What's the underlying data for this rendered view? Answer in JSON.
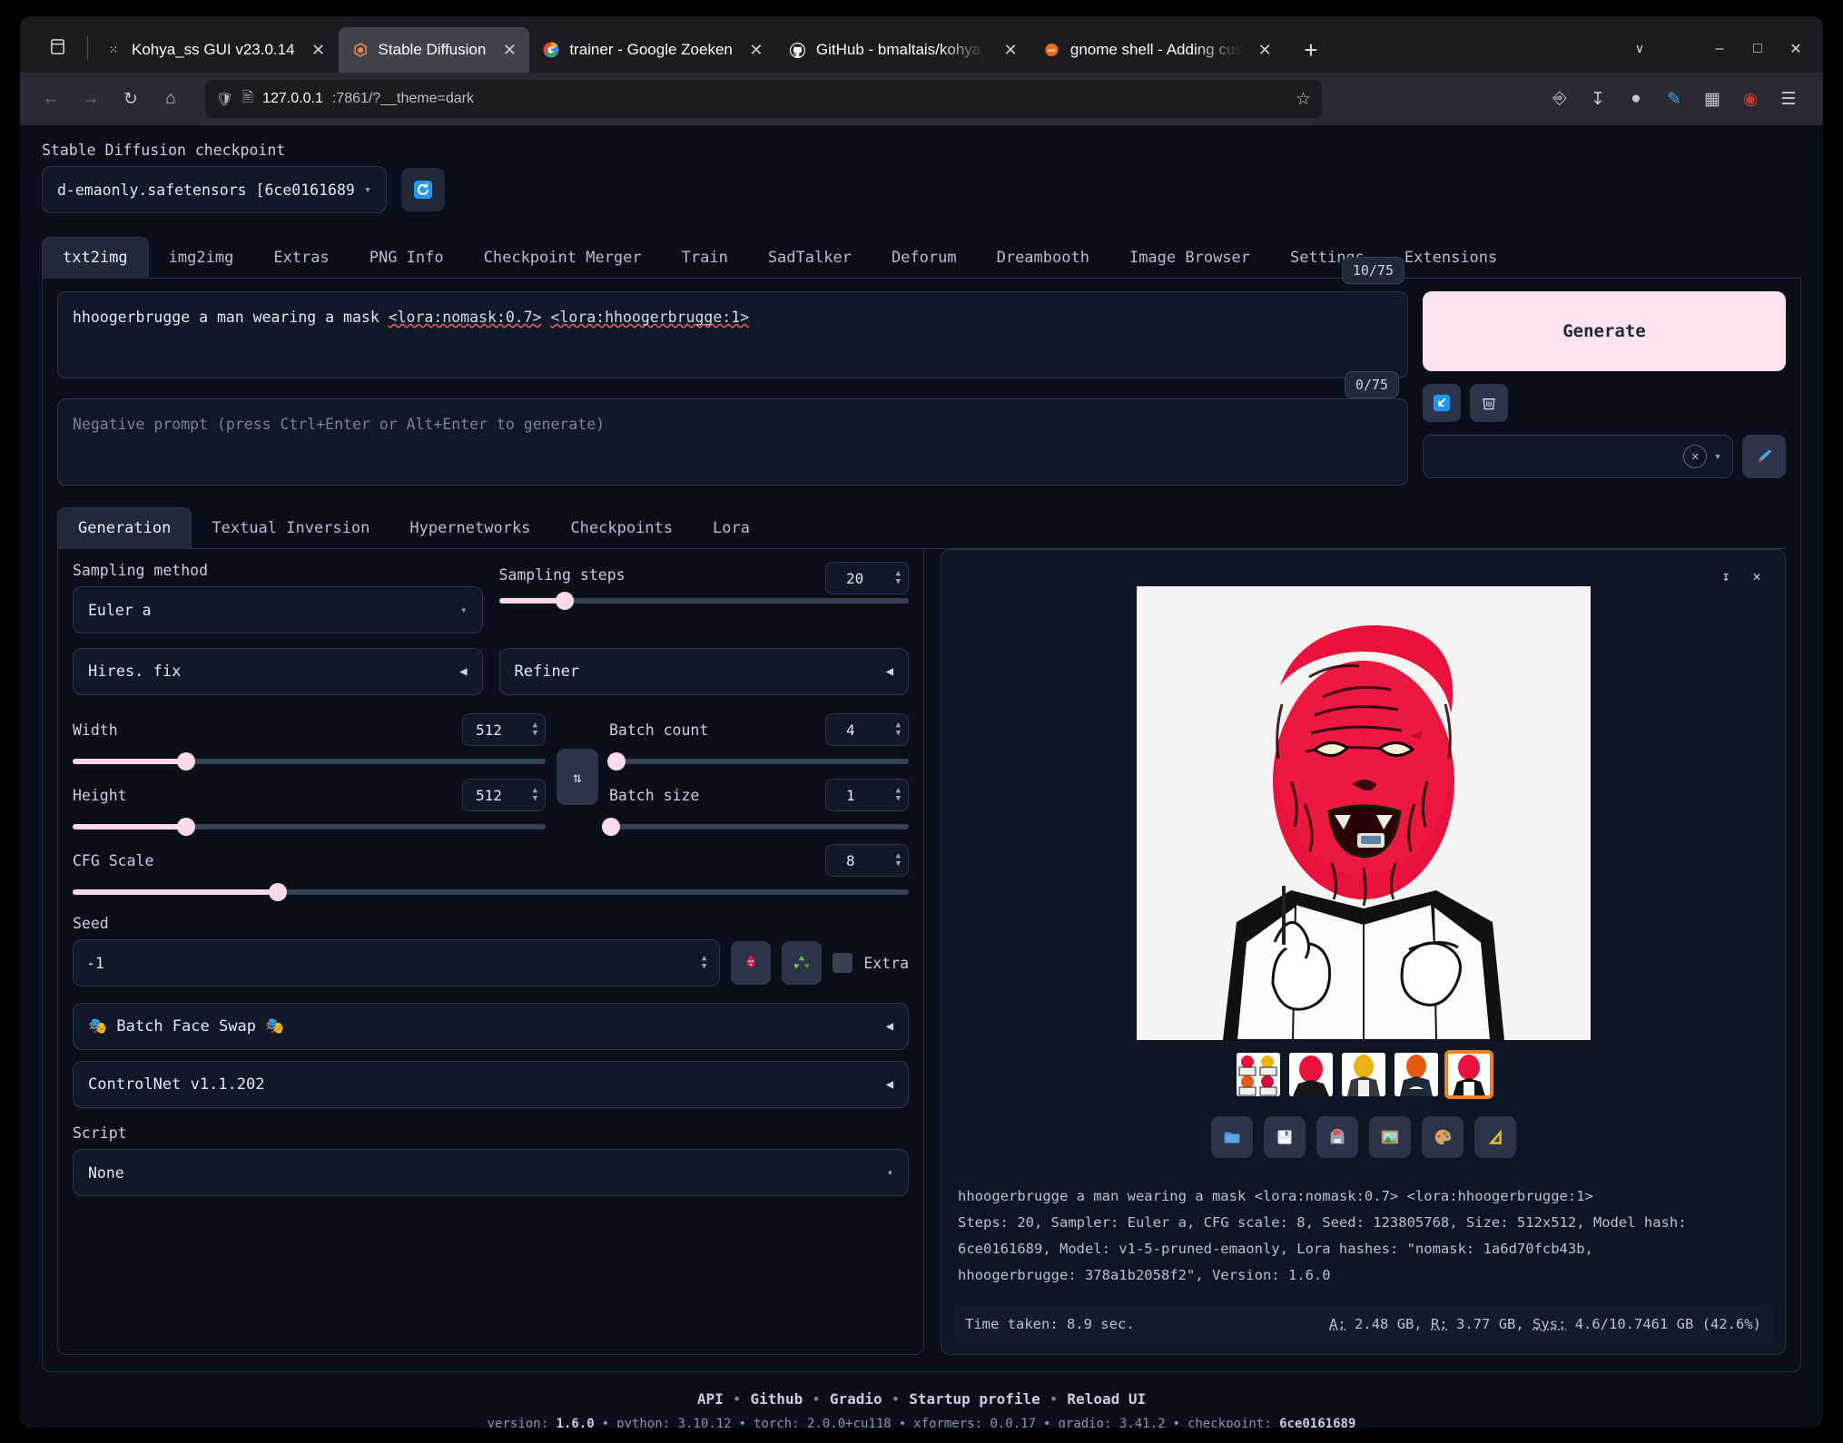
{
  "browser": {
    "tabs": [
      {
        "label": "Kohya_ss GUI v23.0.14",
        "icon": "dots-icon",
        "active": false
      },
      {
        "label": "Stable Diffusion",
        "icon": "gradio-icon",
        "active": true
      },
      {
        "label": "trainer - Google Zoeken",
        "icon": "google-icon",
        "active": false
      },
      {
        "label": "GitHub - bmaltais/kohya_",
        "icon": "github-icon",
        "active": false
      },
      {
        "label": "gnome shell - Adding cust",
        "icon": "askubuntu-icon",
        "active": false
      }
    ],
    "close_label": "✕",
    "newtab_label": "+",
    "list_all_tabs_label": "∨",
    "window_minimize": "–",
    "window_maximize": "□",
    "window_close": "✕",
    "nav": {
      "back": "←",
      "forward": "→",
      "reload": "↻",
      "home": "⌂",
      "bookmark": "☆"
    },
    "url": {
      "host": "127.0.0.1",
      "path": ":7861/?__theme=dark"
    },
    "toolbar_icons": [
      "pocket-icon",
      "downloads-icon",
      "account-icon",
      "color-picker-icon",
      "extensions-icon",
      "ublock-icon",
      "menu-icon"
    ]
  },
  "checkpoint": {
    "label": "Stable Diffusion checkpoint",
    "value": "d-emaonly.safetensors [6ce0161689",
    "caret": "▾",
    "refresh_icon": "refresh-icon"
  },
  "main_tabs": [
    {
      "label": "txt2img",
      "active": true
    },
    {
      "label": "img2img",
      "active": false
    },
    {
      "label": "Extras",
      "active": false
    },
    {
      "label": "PNG Info",
      "active": false
    },
    {
      "label": "Checkpoint Merger",
      "active": false
    },
    {
      "label": "Train",
      "active": false
    },
    {
      "label": "SadTalker",
      "active": false
    },
    {
      "label": "Deforum",
      "active": false
    },
    {
      "label": "Dreambooth",
      "active": false
    },
    {
      "label": "Image Browser",
      "active": false
    },
    {
      "label": "Settings",
      "active": false
    },
    {
      "label": "Extensions",
      "active": false
    }
  ],
  "prompt": {
    "text_plain": "hhoogerbrugge a man wearing a mask ",
    "lora1": "<lora:nomask:0.7>",
    "lora2": "<lora:hhoogerbrugge:1>",
    "counter": "10/75",
    "negative_placeholder": "Negative prompt (press Ctrl+Enter or Alt+Enter to generate)",
    "negative_counter": "0/75"
  },
  "generate": {
    "label": "Generate",
    "paste_icon": "paste-arrow-icon",
    "clear_icon": "trash-icon",
    "styles_clear": "✕",
    "styles_caret": "▾",
    "brush_icon": "paintbrush-icon"
  },
  "sub_tabs": [
    {
      "label": "Generation",
      "active": true
    },
    {
      "label": "Textual Inversion",
      "active": false
    },
    {
      "label": "Hypernetworks",
      "active": false
    },
    {
      "label": "Checkpoints",
      "active": false
    },
    {
      "label": "Lora",
      "active": false
    }
  ],
  "params": {
    "sampling_method_label": "Sampling method",
    "sampling_method_value": "Euler a",
    "sampling_steps_label": "Sampling steps",
    "sampling_steps_value": "20",
    "hires_fix_label": "Hires. fix",
    "refiner_label": "Refiner",
    "width_label": "Width",
    "width_value": "512",
    "height_label": "Height",
    "height_value": "512",
    "cfg_label": "CFG Scale",
    "cfg_value": "8",
    "batch_count_label": "Batch count",
    "batch_count_value": "4",
    "batch_size_label": "Batch size",
    "batch_size_value": "1",
    "swap_icon": "swap-dimensions-icon",
    "seed_label": "Seed",
    "seed_value": "-1",
    "seed_random_icon": "dice-random-icon",
    "seed_recycle_icon": "recycle-icon",
    "extra_label": "Extra",
    "batch_face_swap_label": "🎭 Batch Face Swap 🎭",
    "controlnet_label": "ControlNet v1.1.202",
    "script_label": "Script",
    "script_value": "None",
    "accordion_arrow": "◀",
    "caret": "▾"
  },
  "output": {
    "download_icon": "download-icon",
    "close_icon": "close-icon",
    "buttons": [
      "folder-icon",
      "save-icon",
      "save-zip-icon",
      "send-to-img2img-icon",
      "send-to-inpaint-icon",
      "send-to-extras-icon"
    ],
    "thumbnails": [
      {
        "name": "grid-thumbnail",
        "selected": false
      },
      {
        "name": "image-1-thumbnail",
        "selected": false
      },
      {
        "name": "image-2-thumbnail",
        "selected": false
      },
      {
        "name": "image-3-thumbnail",
        "selected": false
      },
      {
        "name": "image-4-thumbnail",
        "selected": true
      }
    ],
    "info_line1": "hhoogerbrugge a man wearing a mask <lora:nomask:0.7> <lora:hhoogerbrugge:1>",
    "info_line2": "Steps: 20, Sampler: Euler a, CFG scale: 8, Seed: 123805768, Size: 512x512, Model hash:",
    "info_line3": "6ce0161689, Model: v1-5-pruned-emaonly, Lora hashes: \"nomask: 1a6d70fcb43b,",
    "info_line4": "hhoogerbrugge: 378a1b2058f2\", Version: 1.6.0",
    "time_taken": "Time taken: 8.9 sec.",
    "memory_a_key": "A:",
    "memory_a": " 2.48 GB, ",
    "memory_r_key": "R:",
    "memory_r": " 3.77 GB, ",
    "memory_sys_key": "Sys:",
    "memory_sys": " 4.6/10.7461 GB (42.6%)"
  },
  "footer": {
    "links": [
      "API",
      "Github",
      "Gradio",
      "Startup profile",
      "Reload UI"
    ],
    "separator": "•",
    "version_label": "version:",
    "version_value": "1.6.0",
    "python_label": "python:",
    "python_value": "3.10.12",
    "torch_label": "torch:",
    "torch_value": "2.0.0+cu118",
    "xformers_label": "xformers:",
    "xformers_value": "0.0.17",
    "gradio_label": "gradio:",
    "gradio_value": "3.41.2",
    "checkpoint_label": "checkpoint:",
    "checkpoint_value": "6ce0161689"
  },
  "colors": {
    "accent_pink": "#fde2ef",
    "slider_pink": "#fbd9e8",
    "selected_outline": "#ef8021",
    "page_bg": "#0b0f19"
  }
}
